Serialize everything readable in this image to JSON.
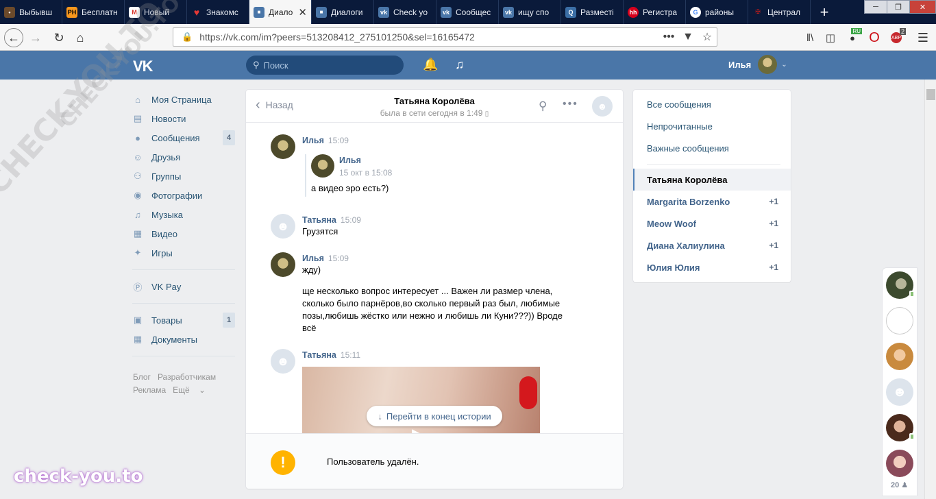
{
  "browser": {
    "tabs": [
      {
        "label": "Выбывш",
        "favicon": "bike",
        "color": "#6b4a2b"
      },
      {
        "label": "Бесплатн",
        "favicon": "PH",
        "color": "#f7971d"
      },
      {
        "label": "Новый",
        "favicon": "mail",
        "color": "#d93025"
      },
      {
        "label": "Знакомс",
        "favicon": "heart",
        "color": "#e53935"
      },
      {
        "label": "Диало",
        "favicon": "vk-chat",
        "color": "#4a76a8"
      },
      {
        "label": "Диалоги",
        "favicon": "vk-chat",
        "color": "#4a76a8"
      },
      {
        "label": "Check yo",
        "favicon": "vk",
        "color": "#4a76a8"
      },
      {
        "label": "Сообщес",
        "favicon": "vk",
        "color": "#4a76a8"
      },
      {
        "label": "ищу спо",
        "favicon": "vk",
        "color": "#4a76a8"
      },
      {
        "label": "Разместі",
        "favicon": "search",
        "color": "#3b6ea5"
      },
      {
        "label": "Регистра",
        "favicon": "hh",
        "color": "#d6001c"
      },
      {
        "label": "районы",
        "favicon": "google",
        "color": "#ffffff"
      },
      {
        "label": "Централ",
        "favicon": "emblem",
        "color": "#b71c1c"
      }
    ],
    "active_tab_index": 4,
    "url": "https://vk.com/im?peers=513208412_275101250&sel=16165472",
    "ext_badges": {
      "ru": "RU",
      "abp": "2"
    }
  },
  "vk": {
    "logo": "VK",
    "search_placeholder": "Поиск",
    "user_name": "Илья"
  },
  "nav": {
    "items": [
      {
        "label": "Моя Страница",
        "icon": "home-icon"
      },
      {
        "label": "Новости",
        "icon": "news-icon"
      },
      {
        "label": "Сообщения",
        "icon": "messages-icon",
        "count": "4"
      },
      {
        "label": "Друзья",
        "icon": "friends-icon"
      },
      {
        "label": "Группы",
        "icon": "groups-icon"
      },
      {
        "label": "Фотографии",
        "icon": "camera-icon"
      },
      {
        "label": "Музыка",
        "icon": "music-icon"
      },
      {
        "label": "Видео",
        "icon": "video-icon"
      },
      {
        "label": "Игры",
        "icon": "games-icon"
      }
    ],
    "vkpay": "VK Pay",
    "goods": "Товары",
    "goods_count": "1",
    "docs": "Документы",
    "footer": {
      "blog": "Блог",
      "dev": "Разработчикам",
      "ads": "Реклама",
      "more": "Ещё"
    }
  },
  "dialog": {
    "back_label": "Назад",
    "name": "Татьяна Королёва",
    "status": "была в сети сегодня в 1:49",
    "messages": [
      {
        "author": "Илья",
        "time": "15:09",
        "forward": {
          "author": "Илья",
          "date": "15 окт в 15:08",
          "text": "а видео эро есть?)"
        }
      },
      {
        "author": "Татьяна",
        "time": "15:09",
        "text": "Грузятся"
      },
      {
        "author": "Илья",
        "time": "15:09",
        "text": "жду)",
        "text2": "ще несколько вопрос интересует ... Важен ли размер члена, сколько было парнёров,во сколько первый раз был, любимые позы,любишь жёстко или нежно и любишь ли Куни???)) Вроде всё"
      },
      {
        "author": "Татьяна",
        "time": "15:11"
      }
    ],
    "scroll_to_end": "Перейти в конец истории",
    "deleted_notice": "Пользователь удалён."
  },
  "right_panel": {
    "filters": [
      "Все сообщения",
      "Непрочитанные",
      "Важные сообщения"
    ],
    "conversations": [
      {
        "name": "Татьяна Королёва",
        "unread": "",
        "selected": true
      },
      {
        "name": "Margarita Borzenko",
        "unread": "+1"
      },
      {
        "name": "Meow Woof",
        "unread": "+1"
      },
      {
        "name": "Диана Халиулина",
        "unread": "+1"
      },
      {
        "name": "Юлия Юлия",
        "unread": "+1"
      }
    ]
  },
  "friends_bar": {
    "count": "20"
  },
  "watermark": {
    "diagonal": "CHECK-YOU.TO",
    "brand": "check-you.to"
  }
}
